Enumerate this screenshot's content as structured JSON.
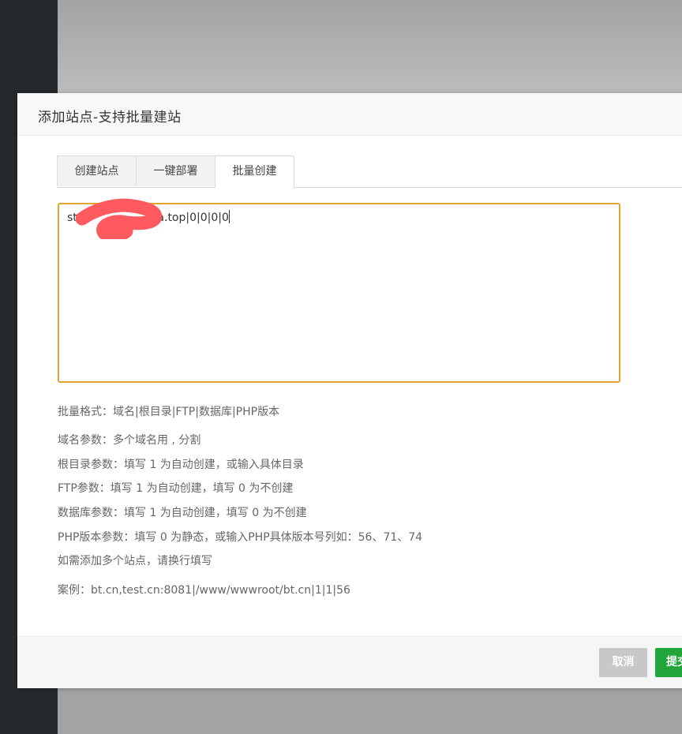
{
  "dialog": {
    "title": "添加站点-支持批量建站",
    "tabs": [
      {
        "label": "创建站点",
        "active": false
      },
      {
        "label": "一键部署",
        "active": false
      },
      {
        "label": "批量创建",
        "active": true
      }
    ],
    "textarea": {
      "value_prefix": "st",
      "value_suffix": "ea.top|0|0|0|0"
    },
    "help": {
      "format": "批量格式：域名|根目录|FTP|数据库|PHP版本",
      "domain": "域名参数：多个域名用 , 分割",
      "root": "根目录参数：填写 1 为自动创建，或输入具体目录",
      "ftp": "FTP参数：填写 1 为自动创建，填写 0 为不创建",
      "database": "数据库参数：填写 1 为自动创建，填写 0 为不创建",
      "php": "PHP版本参数：填写 0 为静态，或输入PHP具体版本号列如：56、71、74",
      "multi": "如需添加多个站点，请换行填写",
      "example": "案例：bt.cn,test.cn:8081|/www/wwwroot/bt.cn|1|1|56"
    },
    "footer": {
      "cancel_label": "取消",
      "submit_label": "提交"
    }
  },
  "colors": {
    "accent_focus": "#e0a52b",
    "submit_green": "#20a53a",
    "cancel_gray": "#c8c8c8",
    "redaction_red": "#ff5a5f"
  }
}
